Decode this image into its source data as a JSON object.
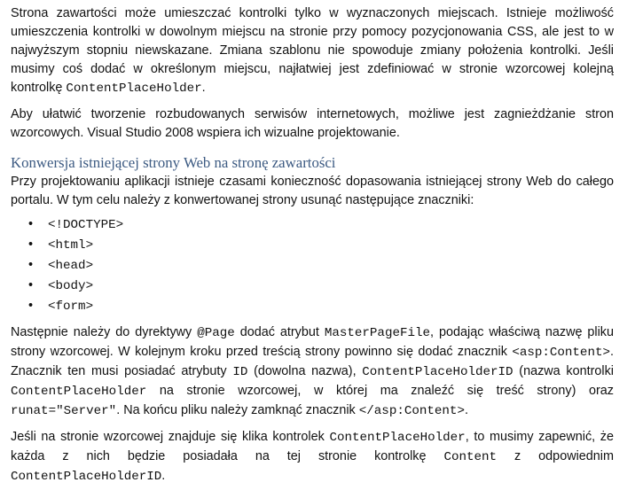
{
  "p1": {
    "t1": "Strona zawartości może umieszczać kontrolki tylko w wyznaczonych miejscach. Istnieje możliwość umieszczenia kontrolki w dowolnym miejscu na stronie przy pomocy pozycjonowania CSS, ale jest to w najwyższym stopniu niewskazane. Zmiana szablonu nie spowoduje zmiany położenia kontrolki. Jeśli musimy coś dodać w określonym miejscu, najłatwiej jest zdefiniować w stronie wzorcowej kolejną kontrolkę ",
    "c1": "ContentPlaceHolder",
    "t2": "."
  },
  "p2": "Aby ułatwić tworzenie rozbudowanych serwisów internetowych, możliwe jest zagnieżdżanie stron wzorcowych. Visual Studio 2008 wspiera ich wizualne projektowanie.",
  "heading": "Konwersja istniejącej strony Web na stronę zawartości",
  "p3": "Przy projektowaniu aplikacji istnieje czasami konieczność dopasowania istniejącej strony Web do całego portalu. W tym celu należy z konwertowanej strony usunąć następujące znaczniki:",
  "bullet_symbol": "•",
  "tags": [
    "<!DOCTYPE>",
    "<html>",
    "<head>",
    "<body>",
    "<form>"
  ],
  "p4": {
    "t1": "Następnie należy do dyrektywy ",
    "c1": "@Page",
    "t2": " dodać atrybut ",
    "c2": "MasterPageFile",
    "t3": ", podając właściwą nazwę pliku strony wzorcowej. W kolejnym kroku przed treścią strony powinno się dodać znacznik ",
    "c3": "<asp:Content>",
    "t4": ". Znacznik ten musi posiadać atrybuty ",
    "c4": "ID",
    "t5": " (dowolna nazwa), ",
    "c5": "ContentPlaceHolderID",
    "t6": " (nazwa kontrolki ",
    "c6": "ContentPlaceHolder",
    "t7": " na stronie wzorcowej, w której ma znaleźć się treść strony) oraz ",
    "c7": "runat=\"Server\"",
    "t8": ". Na końcu pliku należy zamknąć znacznik ",
    "c8": "</asp:Content>",
    "t9": "."
  },
  "p5": {
    "t1": "Jeśli na stronie wzorcowej znajduje się klika kontrolek ",
    "c1": "ContentPlaceHolder",
    "t2": ", to musimy zapewnić, że każda z nich będzie posiadała na tej stronie kontrolkę ",
    "c2": "Content",
    "t3": " z odpowiednim ",
    "c3": "ContentPlaceHolderID",
    "t4": "."
  }
}
